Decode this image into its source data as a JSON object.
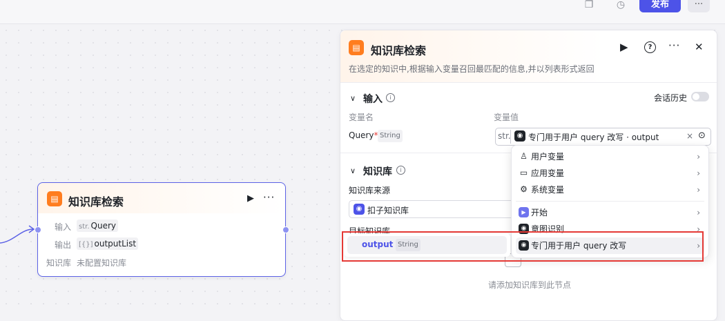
{
  "toolbar": {
    "publish_label": "发布",
    "more_label": "···",
    "history_icon": "history-icon",
    "copy_icon": "copy-icon"
  },
  "node": {
    "title": "知识库检索",
    "run_icon": "▶",
    "more_label": "···",
    "input_label": "输入",
    "input_type": "str.",
    "input_name": "Query",
    "output_label": "输出",
    "output_type": "[{}]",
    "output_name": "outputList",
    "kb_label": "知识库",
    "kb_value": "未配置知识库"
  },
  "panel": {
    "title": "知识库检索",
    "description": "在选定的知识中,根据输入变量召回最匹配的信息,并以列表形式返回",
    "close_label": "✕",
    "help_label": "?",
    "more_label": "···",
    "run_label": "▶",
    "input_section": {
      "title": "输入",
      "history_label": "会话历史",
      "col_name": "变量名",
      "col_value": "变量值",
      "var_name": "Query",
      "required_mark": "*",
      "var_type": "String",
      "value_prefix": "str.",
      "value_text": "专门用于用户 query 改写 · output",
      "clear_label": "×",
      "picker_label": "⊙"
    },
    "kb_section": {
      "title": "知识库",
      "source_label": "知识库来源",
      "source_value": "扣子知识库",
      "target_label": "目标知识库",
      "empty_text": "请添加知识库到此节点"
    }
  },
  "dropdown": {
    "items": [
      {
        "icon": "user-icon",
        "glyph": "♙",
        "label": "用户变量"
      },
      {
        "icon": "folder-icon",
        "glyph": "▭",
        "label": "应用变量"
      },
      {
        "icon": "gear-icon",
        "glyph": "⚙",
        "label": "系统变量"
      },
      {
        "icon": "start-icon",
        "glyph": "▶",
        "label": "开始"
      },
      {
        "icon": "bot-icon",
        "glyph": "◉",
        "label": "意图识别"
      },
      {
        "icon": "bot-icon",
        "glyph": "◉",
        "label": "专门用于用户 query 改写"
      }
    ],
    "submenu": {
      "name": "output",
      "type": "String"
    }
  },
  "colors": {
    "accent": "#4d53e8",
    "kb_orange": "#ff7d1f",
    "highlight_red": "#e53935"
  }
}
